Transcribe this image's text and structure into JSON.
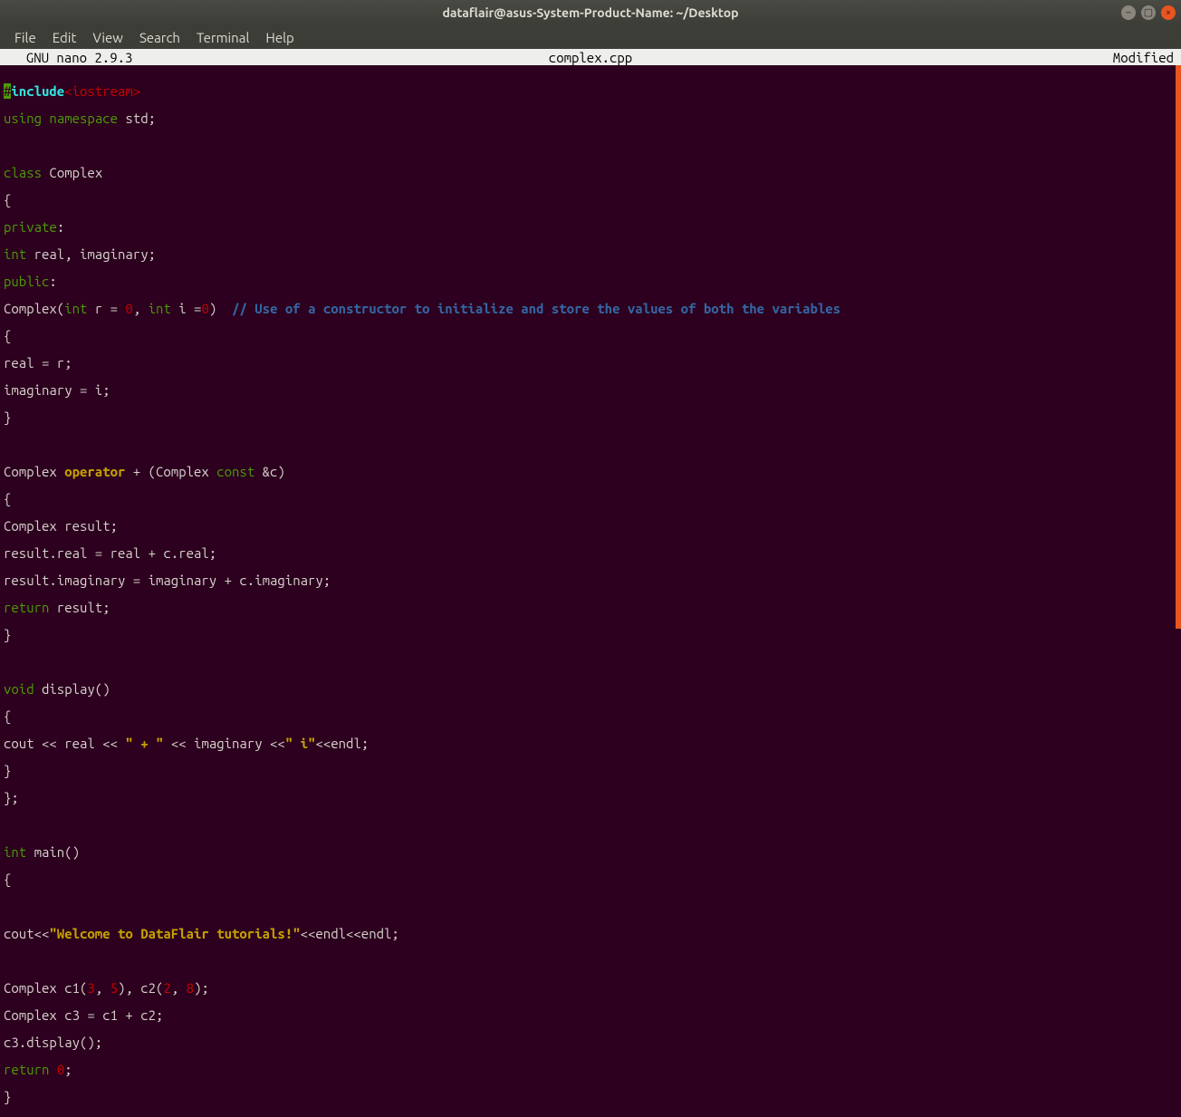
{
  "window": {
    "title": "dataflair@asus-System-Product-Name: ~/Desktop"
  },
  "menu": {
    "file": "File",
    "edit": "Edit",
    "view": "View",
    "search": "Search",
    "terminal": "Terminal",
    "help": "Help"
  },
  "status": {
    "left": "  GNU nano 2.9.3",
    "center": "complex.cpp",
    "right": "Modified"
  },
  "code": {
    "l1a": "#",
    "l1b": "include",
    "l1c": "<iostream>",
    "l2a": "using",
    "l2b": " ",
    "l2c": "namespace",
    "l2d": " std;",
    "l4a": "class",
    "l4b": " Complex",
    "l5": "{",
    "l6a": "private",
    "l6b": ":",
    "l7a": "int",
    "l7b": " real, imaginary;",
    "l8a": "public",
    "l8b": ":",
    "l9a": "Complex(",
    "l9b": "int",
    "l9c": " r = ",
    "l9d": "0",
    "l9e": ", ",
    "l9f": "int",
    "l9g": " i =",
    "l9h": "0",
    "l9i": ")  ",
    "l9j": "// Use of a constructor to initialize and store the values of both the variables",
    "l10": "{",
    "l11": "real = r;",
    "l12": "imaginary = i;",
    "l13": "}",
    "l15a": "Complex ",
    "l15b": "operator",
    "l15c": " + (Complex ",
    "l15d": "const",
    "l15e": " &c)",
    "l16": "{",
    "l17": "Complex result;",
    "l18": "result.real = real + c.real;",
    "l19": "result.imaginary = imaginary + c.imaginary;",
    "l20a": "return",
    "l20b": " result;",
    "l21": "}",
    "l23a": "void",
    "l23b": " display()",
    "l24": "{",
    "l25a": "cout << real << ",
    "l25b": "\" + \"",
    "l25c": " << imaginary <<",
    "l25d": "\" i\"",
    "l25e": "<<endl;",
    "l26": "}",
    "l27": "};",
    "l29a": "int",
    "l29b": " main()",
    "l30": "{",
    "l32a": "cout<<",
    "l32b": "\"Welcome to DataFlair tutorials!\"",
    "l32c": "<<endl<<endl;",
    "l34a": "Complex c1(",
    "l34b": "3",
    "l34c": ", ",
    "l34d": "5",
    "l34e": "), c2(",
    "l34f": "2",
    "l34g": ", ",
    "l34h": "8",
    "l34i": ");",
    "l35": "Complex c3 = c1 + c2;",
    "l36": "c3.display();",
    "l37a": "return",
    "l37b": " ",
    "l37c": "0",
    "l37d": ";",
    "l38": "}"
  }
}
